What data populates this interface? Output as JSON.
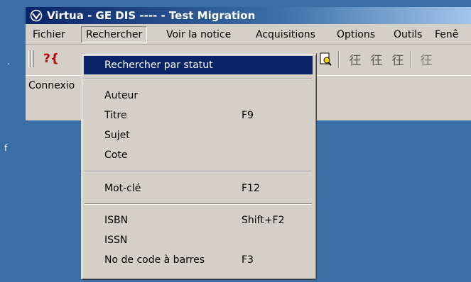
{
  "window": {
    "title": "Virtua - GE DIS ---- - Test Migration"
  },
  "menubar": {
    "items": [
      {
        "label": "Fichier"
      },
      {
        "label": "Rechercher"
      },
      {
        "label": "Voir la notice"
      },
      {
        "label": "Acquisitions"
      },
      {
        "label": "Options"
      },
      {
        "label": "Outils"
      },
      {
        "label": "Fenê"
      }
    ]
  },
  "statusrow": {
    "connection_label": "Connexio"
  },
  "menu": {
    "highlighted": {
      "label": "Rechercher par statut"
    },
    "items": [
      {
        "label": "Auteur",
        "shortcut": ""
      },
      {
        "label": "Titre",
        "shortcut": "F9"
      },
      {
        "label": "Sujet",
        "shortcut": ""
      },
      {
        "label": "Cote",
        "shortcut": ""
      },
      {
        "label": "Mot-clé",
        "shortcut": "F12"
      },
      {
        "label": "ISBN",
        "shortcut": "Shift+F2"
      },
      {
        "label": "ISSN",
        "shortcut": ""
      },
      {
        "label": "No de code à barres",
        "shortcut": "F3"
      }
    ]
  },
  "desktop": {
    "glyphs": [
      ".",
      "f"
    ]
  },
  "toolbar": {
    "icons": [
      "help-context-icon",
      "document-search-icon",
      "record-icon-1",
      "record-icon-2",
      "record-icon-3",
      "record-icon-4"
    ]
  },
  "colors": {
    "desktop": "#3a6ea5",
    "titlebar": "#0a246a",
    "highlight": "#0a246a",
    "face": "#d4d0c8"
  }
}
